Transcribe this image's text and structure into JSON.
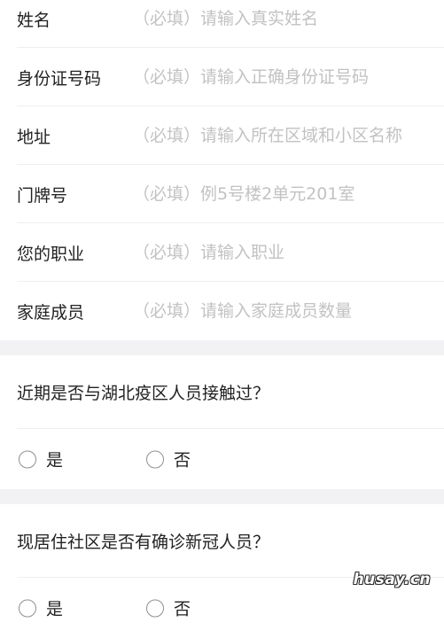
{
  "fields": [
    {
      "label": "姓名",
      "placeholder": "（必填）请输入真实姓名"
    },
    {
      "label": "身份证号码",
      "placeholder": "（必填）请输入正确身份证号码"
    },
    {
      "label": "地址",
      "placeholder": "（必填）请输入所在区域和小区名称"
    },
    {
      "label": "门牌号",
      "placeholder": "（必填）例5号楼2单元201室"
    },
    {
      "label": "您的职业",
      "placeholder": "（必填）请输入职业"
    },
    {
      "label": "家庭成员",
      "placeholder": "（必填）请输入家庭成员数量"
    }
  ],
  "questions": [
    {
      "text": "近期是否与湖北疫区人员接触过？",
      "options": [
        "是",
        "否"
      ]
    },
    {
      "text": "现居住社区是否有确诊新冠人员？",
      "options": [
        "是",
        "否"
      ]
    }
  ],
  "watermark": "husay.cn"
}
